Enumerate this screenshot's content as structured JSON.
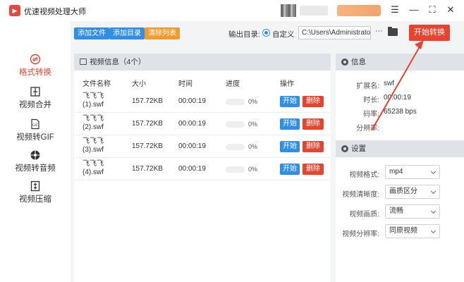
{
  "titlebar": {
    "title": "优速视频处理大师",
    "app_icon": "▶"
  },
  "window_controls": {
    "menu": "☰",
    "minimize": "—",
    "maximize": "⛶",
    "close": "✕"
  },
  "sidebar": {
    "items": [
      {
        "label": "格式转换",
        "icon": "format-convert-icon",
        "active": true
      },
      {
        "label": "视频合并",
        "icon": "merge-icon",
        "active": false
      },
      {
        "label": "视频转GIF",
        "icon": "gif-icon",
        "active": false
      },
      {
        "label": "视频转音频",
        "icon": "audio-icon",
        "active": false
      },
      {
        "label": "视频压缩",
        "icon": "compress-icon",
        "active": false
      }
    ]
  },
  "toolbar": {
    "add_file": "添加文件",
    "add_folder": "添加目录",
    "clear_list": "清除列表",
    "output_label": "输出目录:",
    "output_option": "自定义",
    "output_path": "C:\\Users\\Administrator\\",
    "more": "···",
    "start_all": "开始转换"
  },
  "video_panel": {
    "title": "视频信息（4个）",
    "columns": [
      "文件名称",
      "大小",
      "时间",
      "进度",
      "操作"
    ],
    "rows": [
      {
        "name": "飞飞飞 (1).swf",
        "size": "157.72KB",
        "time": "00:00:19",
        "progress": "0%",
        "progress_value": 0,
        "start": "开始",
        "delete": "删除"
      },
      {
        "name": "飞飞飞 (2).swf",
        "size": "157.72KB",
        "time": "00:00:19",
        "progress": "0%",
        "progress_value": 0,
        "start": "开始",
        "delete": "删除"
      },
      {
        "name": "飞飞飞 (3).swf",
        "size": "157.72KB",
        "time": "00:00:19",
        "progress": "0%",
        "progress_value": 0,
        "start": "开始",
        "delete": "删除"
      },
      {
        "name": "飞飞飞 (4).swf",
        "size": "157.72KB",
        "time": "00:00:19",
        "progress": "0%",
        "progress_value": 0,
        "start": "开始",
        "delete": "删除"
      }
    ]
  },
  "info_panel": {
    "title": "信息",
    "fields": [
      {
        "key": "扩展名:",
        "value": "swf"
      },
      {
        "key": "时长:",
        "value": "00:00:19"
      },
      {
        "key": "码率:",
        "value": "65238 bps"
      },
      {
        "key": "分辨率:",
        "value": ""
      }
    ]
  },
  "settings_panel": {
    "title": "设置",
    "fields": [
      {
        "key": "视频格式:",
        "value": "mp4"
      },
      {
        "key": "视频清晰度:",
        "value": "画质区分"
      },
      {
        "key": "视频画质:",
        "value": "流畅"
      },
      {
        "key": "视频分辨率:",
        "value": "同原视频"
      }
    ]
  },
  "colors": {
    "accent_red": "#e7432f",
    "accent_blue": "#2f8fe8",
    "accent_orange": "#f39a2a"
  }
}
